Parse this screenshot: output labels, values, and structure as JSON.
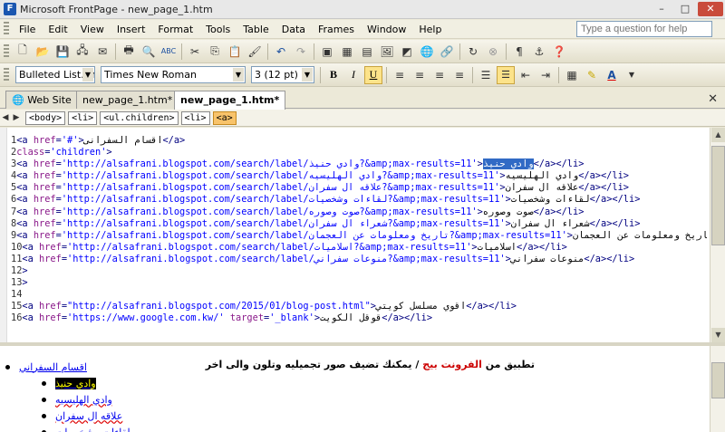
{
  "window": {
    "title": "Microsoft FrontPage - new_page_1.htm"
  },
  "menu": [
    {
      "label": "File",
      "u": "F"
    },
    {
      "label": "Edit",
      "u": "E"
    },
    {
      "label": "View",
      "u": "V"
    },
    {
      "label": "Insert",
      "u": "I"
    },
    {
      "label": "Format",
      "u": "o"
    },
    {
      "label": "Tools",
      "u": "T"
    },
    {
      "label": "Table",
      "u": "a"
    },
    {
      "label": "Data",
      "u": "D"
    },
    {
      "label": "Frames",
      "u": "r"
    },
    {
      "label": "Window",
      "u": "W"
    },
    {
      "label": "Help",
      "u": "H"
    }
  ],
  "ask_placeholder": "Type a question for help",
  "format_toolbar": {
    "style": "Bulleted List.ch",
    "font": "Times New Roman",
    "size": "3 (12 pt)",
    "bold": "B",
    "italic": "I",
    "underline": "U"
  },
  "tabs": [
    {
      "label": "Web Site"
    },
    {
      "label": "new_page_1.htm*"
    },
    {
      "label": "new_page_1.htm*"
    }
  ],
  "tag_path": [
    "<body>",
    "<li>",
    "<ul.children>",
    "<li>",
    "<a>"
  ],
  "code_lines": [
    {
      "n": "1",
      "segs": [
        [
          "tg",
          "<a "
        ],
        [
          "at",
          "href"
        ],
        [
          "tg",
          "="
        ],
        [
          "vl",
          "'#'"
        ],
        [
          "tg",
          ">"
        ],
        [
          "tx",
          "اقسام السفرانى"
        ],
        [
          "tg",
          "</a>"
        ]
      ]
    },
    {
      "n": "2",
      "segs": [
        [
          "at",
          "class"
        ],
        [
          "tg",
          "="
        ],
        [
          "vl",
          "'children'"
        ],
        [
          "tg",
          ">"
        ]
      ]
    },
    {
      "n": "3",
      "segs": [
        [
          "tg",
          "<a "
        ],
        [
          "at",
          "href"
        ],
        [
          "tg",
          "="
        ],
        [
          "vl",
          "'http://alsafrani.blogspot.com/search/label/وادي حنيذ?&amp;max-results=11'"
        ],
        [
          "tg",
          ">"
        ],
        [
          "hl",
          "وادي حنيذ"
        ],
        [
          "tg",
          "</a></li>"
        ]
      ]
    },
    {
      "n": "4",
      "segs": [
        [
          "tg",
          "<a "
        ],
        [
          "at",
          "href"
        ],
        [
          "tg",
          "="
        ],
        [
          "vl",
          "'http://alsafrani.blogspot.com/search/label/وادي الهليسيه?&amp;max-results=11'"
        ],
        [
          "tg",
          ">"
        ],
        [
          "tx",
          "وادي الهليسيه"
        ],
        [
          "tg",
          "</a></li>"
        ]
      ]
    },
    {
      "n": "5",
      "segs": [
        [
          "tg",
          "<a "
        ],
        [
          "at",
          "href"
        ],
        [
          "tg",
          "="
        ],
        [
          "vl",
          "'http://alsafrani.blogspot.com/search/label/علاقه ال سفران?&amp;max-results=11'"
        ],
        [
          "tg",
          ">"
        ],
        [
          "tx",
          "علاقه ال سفران"
        ],
        [
          "tg",
          "</a></li>"
        ]
      ]
    },
    {
      "n": "6",
      "segs": [
        [
          "tg",
          "<a "
        ],
        [
          "at",
          "href"
        ],
        [
          "tg",
          "="
        ],
        [
          "vl",
          "'http://alsafrani.blogspot.com/search/label/لقاءات وشخصيات?&amp;max-results=11'"
        ],
        [
          "tg",
          ">"
        ],
        [
          "tx",
          "لقاءات وشخصيات"
        ],
        [
          "tg",
          "</a></li>"
        ]
      ]
    },
    {
      "n": "7",
      "segs": [
        [
          "tg",
          "<a "
        ],
        [
          "at",
          "href"
        ],
        [
          "tg",
          "="
        ],
        [
          "vl",
          "'http://alsafrani.blogspot.com/search/label/صوت وصوره?&amp;max-results=11'"
        ],
        [
          "tg",
          ">"
        ],
        [
          "tx",
          "صوت وصوره"
        ],
        [
          "tg",
          "</a></li>"
        ]
      ]
    },
    {
      "n": "8",
      "segs": [
        [
          "tg",
          "<a "
        ],
        [
          "at",
          "href"
        ],
        [
          "tg",
          "="
        ],
        [
          "vl",
          "'http://alsafrani.blogspot.com/search/label/شعراء ال سفران?&amp;max-results=11'"
        ],
        [
          "tg",
          ">"
        ],
        [
          "tx",
          "شعراء ال سفران"
        ],
        [
          "tg",
          "</a></li>"
        ]
      ]
    },
    {
      "n": "9",
      "segs": [
        [
          "tg",
          "<a "
        ],
        [
          "at",
          "href"
        ],
        [
          "tg",
          "="
        ],
        [
          "vl",
          "'http://alsafrani.blogspot.com/search/label/تاريخ ومعلومات عن العجمان?&amp;max-results=11'"
        ],
        [
          "tg",
          ">"
        ],
        [
          "tx",
          "تاريخ ومعلومات عن العجمان"
        ],
        [
          "tg",
          "</a></li>"
        ]
      ]
    },
    {
      "n": "10",
      "segs": [
        [
          "tg",
          "<a "
        ],
        [
          "at",
          "href"
        ],
        [
          "tg",
          "="
        ],
        [
          "vl",
          "'http://alsafrani.blogspot.com/search/label/اسلاميات?&amp;max-results=11'"
        ],
        [
          "tg",
          ">"
        ],
        [
          "tx",
          "اسلاميات"
        ],
        [
          "tg",
          "</a></li>"
        ]
      ]
    },
    {
      "n": "11",
      "segs": [
        [
          "tg",
          "<a "
        ],
        [
          "at",
          "href"
        ],
        [
          "tg",
          "="
        ],
        [
          "vl",
          "'http://alsafrani.blogspot.com/search/label/منوعات سفراني?&amp;max-results=11'"
        ],
        [
          "tg",
          ">"
        ],
        [
          "tx",
          "منوعات سفراني"
        ],
        [
          "tg",
          "</a></li>"
        ]
      ]
    },
    {
      "n": "12",
      "segs": [
        [
          "tg",
          ">"
        ]
      ]
    },
    {
      "n": "13",
      "segs": [
        [
          "tg",
          ">"
        ]
      ]
    },
    {
      "n": "14",
      "segs": []
    },
    {
      "n": "15",
      "segs": [
        [
          "tg",
          "<a "
        ],
        [
          "at",
          "href"
        ],
        [
          "tg",
          "="
        ],
        [
          "vl",
          "\"http://alsafrani.blogspot.com/2015/01/blog-post.html\""
        ],
        [
          "tg",
          ">"
        ],
        [
          "tx",
          "اقوي مسلسل كويتي"
        ],
        [
          "tg",
          "</a></li>"
        ]
      ]
    },
    {
      "n": "16",
      "segs": [
        [
          "tg",
          "<a "
        ],
        [
          "at",
          "href"
        ],
        [
          "tg",
          "="
        ],
        [
          "vl",
          "'https://www.google.com.kw/'"
        ],
        [
          "at",
          " target"
        ],
        [
          "tg",
          "="
        ],
        [
          "vl",
          "'_blank'"
        ],
        [
          "tg",
          ">"
        ],
        [
          "tx",
          "قوقل الكويت"
        ],
        [
          "tg",
          "</a></li>"
        ]
      ]
    }
  ],
  "design": {
    "heading_parts": [
      {
        "text": "تطبيق من ",
        "red": false
      },
      {
        "text": "الفرونت بيج",
        "red": true
      },
      {
        "text": " / يمكنك تضيف صور تجميليه وتلون ",
        "red": false
      },
      {
        "text": "والى اخر",
        "red": false
      }
    ],
    "top_link": "اقسام السفراني",
    "sub_links": [
      {
        "text": "وادي حنيذ",
        "selected": true
      },
      {
        "text": "وادي الهليسيه",
        "selected": false
      },
      {
        "text": "علاقه ال سفران",
        "selected": false
      },
      {
        "text": "لقاءات وشخصيات",
        "selected": false
      }
    ]
  }
}
